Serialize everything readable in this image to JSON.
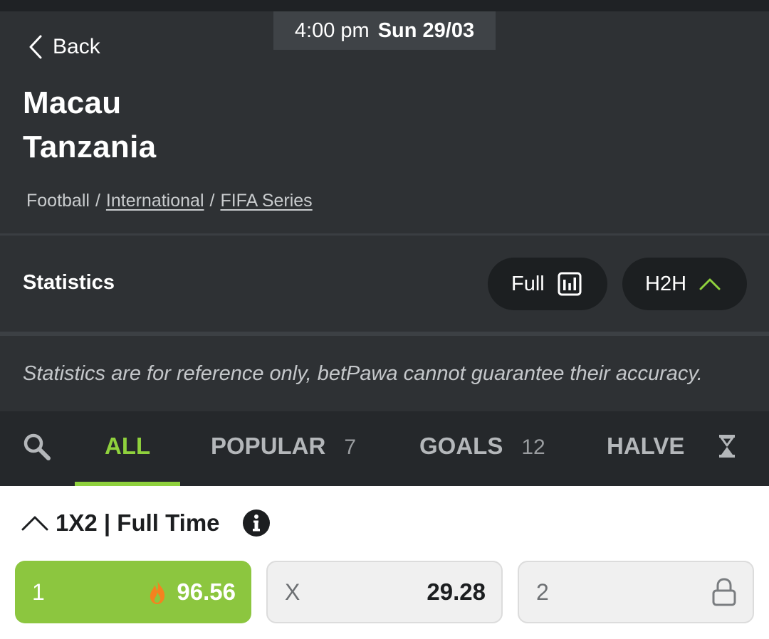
{
  "header": {
    "time": "4:00 pm",
    "date": "Sun 29/03",
    "back_label": "Back",
    "home_team": "Macau",
    "away_team": "Tanzania",
    "breadcrumb": {
      "sport": "Football",
      "separator": "/",
      "category": "International",
      "tournament": "FIFA Series"
    }
  },
  "statistics": {
    "title": "Statistics",
    "full_label": "Full",
    "h2h_label": "H2H",
    "notice": "Statistics are for reference only, betPawa cannot guarantee their accuracy."
  },
  "tabs": [
    {
      "label": "ALL",
      "count": "",
      "active": true
    },
    {
      "label": "POPULAR",
      "count": "7"
    },
    {
      "label": "GOALS",
      "count": "12"
    },
    {
      "label": "HALVE",
      "count": ""
    }
  ],
  "market": {
    "title": "1X2 | Full Time",
    "outcomes": [
      {
        "label": "1",
        "odds": "96.56",
        "selected": true,
        "icon": "fire-icon"
      },
      {
        "label": "X",
        "odds": "29.28"
      },
      {
        "label": "2",
        "odds": "",
        "locked": true,
        "icon": "lock-icon"
      }
    ]
  },
  "colors": {
    "accent_green": "#8fd13d",
    "selected_odd_bg": "#8cc63f",
    "header_bg": "#2e3134",
    "tabs_bg": "#25282b",
    "fire": "#f5821f"
  }
}
